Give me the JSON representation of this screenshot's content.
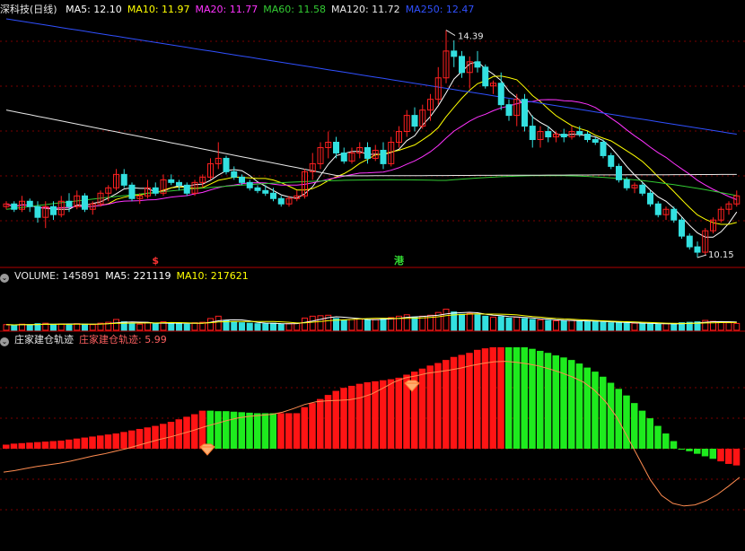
{
  "panel_main": {
    "title": "深科技(日线)",
    "ma": [
      {
        "label": "MA5: 12.10",
        "color": "#ffffff"
      },
      {
        "label": "MA10: 11.97",
        "color": "#ffff00"
      },
      {
        "label": "MA20: 11.77",
        "color": "#ff33ff"
      },
      {
        "label": "MA60: 11.58",
        "color": "#33cc33"
      },
      {
        "label": "MA120: 11.72",
        "color": "#e8e8e8"
      },
      {
        "label": "MA250: 12.47",
        "color": "#3050ff"
      }
    ],
    "high_label": "14.39",
    "low_label": "10.15",
    "markers": [
      {
        "text": "$",
        "color": "#ff3333"
      },
      {
        "text": "港",
        "color": "#33dd33"
      }
    ]
  },
  "panel_volume": {
    "items": [
      {
        "label": "VOLUME: 145891",
        "color": "#e8e8e8"
      },
      {
        "label": "MA5: 221119",
        "color": "#ffffff"
      },
      {
        "label": "MA10: 217621",
        "color": "#ffff00"
      }
    ]
  },
  "panel_indicator": {
    "title": "庄家建仓轨迹",
    "value_label": "庄家建仓轨迹: 5.99",
    "value_color": "#ff6060"
  },
  "colors": {
    "up": "#ff2020",
    "down": "#33e0e0",
    "bar_up": "#ff1414",
    "bar_down": "#1eeb1e",
    "curve": "#ff8c50",
    "grid": "#7a0000"
  },
  "chart_data": {
    "type": "candlestick",
    "series": [
      {
        "name": "深科技(日线)",
        "type": "candlestick",
        "ohlc": [
          [
            11.1,
            11.2,
            11.05,
            11.15
          ],
          [
            11.15,
            11.2,
            11.0,
            11.05
          ],
          [
            11.05,
            11.3,
            11.0,
            11.2
          ],
          [
            11.2,
            11.25,
            11.0,
            11.1
          ],
          [
            11.1,
            11.2,
            10.8,
            10.9
          ],
          [
            10.9,
            11.2,
            10.7,
            11.1
          ],
          [
            11.1,
            11.2,
            10.85,
            10.95
          ],
          [
            10.95,
            11.3,
            10.9,
            11.2
          ],
          [
            11.2,
            11.35,
            11.0,
            11.1
          ],
          [
            11.1,
            11.4,
            11.05,
            11.3
          ],
          [
            11.3,
            11.35,
            11.0,
            11.05
          ],
          [
            11.05,
            11.2,
            10.95,
            11.15
          ],
          [
            11.15,
            11.4,
            11.1,
            11.35
          ],
          [
            11.35,
            11.5,
            11.2,
            11.45
          ],
          [
            11.45,
            11.8,
            11.4,
            11.7
          ],
          [
            11.7,
            11.8,
            11.45,
            11.5
          ],
          [
            11.5,
            11.55,
            11.2,
            11.25
          ],
          [
            11.25,
            11.35,
            11.15,
            11.3
          ],
          [
            11.3,
            11.6,
            11.25,
            11.45
          ],
          [
            11.45,
            11.55,
            11.3,
            11.35
          ],
          [
            11.35,
            11.7,
            11.3,
            11.6
          ],
          [
            11.6,
            11.7,
            11.5,
            11.55
          ],
          [
            11.55,
            11.6,
            11.4,
            11.5
          ],
          [
            11.5,
            11.55,
            11.3,
            11.35
          ],
          [
            11.35,
            11.6,
            11.3,
            11.55
          ],
          [
            11.55,
            11.7,
            11.45,
            11.65
          ],
          [
            11.65,
            12.0,
            11.6,
            11.9
          ],
          [
            11.9,
            12.3,
            11.8,
            12.0
          ],
          [
            12.0,
            12.05,
            11.7,
            11.75
          ],
          [
            11.75,
            11.85,
            11.6,
            11.65
          ],
          [
            11.65,
            11.7,
            11.5,
            11.55
          ],
          [
            11.55,
            11.6,
            11.4,
            11.45
          ],
          [
            11.45,
            11.5,
            11.35,
            11.4
          ],
          [
            11.4,
            11.5,
            11.3,
            11.35
          ],
          [
            11.35,
            11.45,
            11.2,
            11.25
          ],
          [
            11.25,
            11.3,
            11.1,
            11.15
          ],
          [
            11.15,
            11.3,
            11.1,
            11.25
          ],
          [
            11.25,
            11.4,
            11.2,
            11.3
          ],
          [
            11.3,
            11.8,
            11.25,
            11.75
          ],
          [
            11.75,
            12.1,
            11.6,
            11.9
          ],
          [
            11.9,
            12.3,
            11.8,
            12.2
          ],
          [
            12.2,
            12.5,
            12.0,
            12.3
          ],
          [
            12.3,
            12.4,
            12.0,
            12.1
          ],
          [
            12.1,
            12.2,
            11.9,
            11.95
          ],
          [
            11.95,
            12.2,
            11.9,
            12.1
          ],
          [
            12.1,
            12.3,
            12.0,
            12.2
          ],
          [
            12.2,
            12.3,
            11.9,
            12.0
          ],
          [
            12.0,
            12.25,
            11.95,
            12.15
          ],
          [
            12.15,
            12.3,
            11.8,
            11.9
          ],
          [
            11.9,
            12.4,
            11.85,
            12.3
          ],
          [
            12.3,
            12.6,
            12.2,
            12.5
          ],
          [
            12.5,
            12.9,
            12.4,
            12.8
          ],
          [
            12.8,
            12.95,
            12.5,
            12.6
          ],
          [
            12.6,
            13.0,
            12.55,
            12.9
          ],
          [
            12.9,
            13.2,
            12.7,
            13.1
          ],
          [
            13.1,
            13.7,
            13.0,
            13.5
          ],
          [
            13.5,
            14.39,
            13.4,
            14.0
          ],
          [
            14.0,
            14.2,
            13.7,
            13.9
          ],
          [
            13.9,
            14.0,
            13.5,
            13.6
          ],
          [
            13.6,
            13.9,
            13.3,
            13.8
          ],
          [
            13.8,
            14.0,
            13.6,
            13.7
          ],
          [
            13.7,
            13.75,
            13.3,
            13.35
          ],
          [
            13.35,
            13.45,
            13.2,
            13.4
          ],
          [
            13.4,
            13.6,
            12.9,
            13.0
          ],
          [
            13.0,
            13.1,
            12.7,
            12.8
          ],
          [
            12.8,
            13.2,
            12.6,
            13.1
          ],
          [
            13.1,
            13.2,
            12.5,
            12.6
          ],
          [
            12.6,
            12.8,
            12.2,
            12.35
          ],
          [
            12.35,
            12.6,
            12.2,
            12.5
          ],
          [
            12.5,
            12.6,
            12.3,
            12.4
          ],
          [
            12.4,
            12.5,
            12.3,
            12.45
          ],
          [
            12.45,
            12.55,
            12.3,
            12.4
          ],
          [
            12.4,
            12.6,
            12.35,
            12.5
          ],
          [
            12.5,
            12.6,
            12.4,
            12.45
          ],
          [
            12.45,
            12.5,
            12.3,
            12.35
          ],
          [
            12.35,
            12.4,
            12.25,
            12.3
          ],
          [
            12.3,
            12.35,
            12.0,
            12.05
          ],
          [
            12.05,
            12.1,
            11.8,
            11.85
          ],
          [
            11.85,
            11.9,
            11.55,
            11.6
          ],
          [
            11.6,
            11.65,
            11.4,
            11.45
          ],
          [
            11.45,
            11.55,
            11.35,
            11.5
          ],
          [
            11.5,
            11.55,
            11.3,
            11.35
          ],
          [
            11.35,
            11.4,
            11.1,
            11.15
          ],
          [
            11.15,
            11.2,
            10.9,
            10.95
          ],
          [
            10.95,
            11.1,
            10.85,
            11.05
          ],
          [
            11.05,
            11.1,
            10.8,
            10.85
          ],
          [
            10.85,
            10.9,
            10.5,
            10.55
          ],
          [
            10.55,
            10.6,
            10.3,
            10.35
          ],
          [
            10.35,
            10.45,
            10.15,
            10.25
          ],
          [
            10.25,
            10.7,
            10.2,
            10.65
          ],
          [
            10.65,
            10.9,
            10.6,
            10.85
          ],
          [
            10.85,
            11.1,
            10.8,
            11.05
          ],
          [
            11.05,
            11.2,
            10.95,
            11.15
          ],
          [
            11.15,
            11.4,
            11.1,
            11.3
          ]
        ]
      }
    ],
    "volume": [
      120,
      110,
      130,
      115,
      140,
      150,
      120,
      135,
      125,
      140,
      130,
      120,
      150,
      170,
      230,
      180,
      150,
      130,
      160,
      140,
      180,
      150,
      140,
      130,
      160,
      170,
      250,
      300,
      210,
      180,
      160,
      150,
      140,
      140,
      150,
      130,
      140,
      150,
      260,
      300,
      310,
      320,
      250,
      210,
      230,
      240,
      220,
      230,
      250,
      270,
      300,
      330,
      280,
      300,
      320,
      380,
      450,
      390,
      340,
      360,
      330,
      300,
      280,
      290,
      260,
      280,
      250,
      230,
      220,
      210,
      200,
      200,
      210,
      200,
      190,
      180,
      170,
      160,
      160,
      150,
      150,
      140,
      140,
      130,
      140,
      130,
      160,
      170,
      180,
      210,
      190,
      170,
      160,
      146
    ],
    "ma_lines": [
      "MA5",
      "MA10",
      "MA20",
      "MA60",
      "MA120",
      "MA250"
    ],
    "indicator_bars": [
      8,
      10,
      11,
      12,
      13,
      14,
      15,
      16,
      18,
      20,
      22,
      24,
      26,
      28,
      30,
      33,
      36,
      39,
      42,
      45,
      49,
      53,
      58,
      63,
      68,
      75,
      75,
      74,
      74,
      73,
      72,
      71,
      70,
      70,
      70,
      70,
      70,
      70,
      82,
      90,
      98,
      106,
      114,
      120,
      124,
      128,
      131,
      133,
      135,
      137,
      140,
      146,
      152,
      158,
      164,
      169,
      175,
      181,
      185,
      189,
      195,
      198,
      200,
      200,
      200,
      200,
      200,
      197,
      193,
      189,
      184,
      180,
      175,
      168,
      160,
      152,
      142,
      130,
      118,
      105,
      90,
      75,
      60,
      45,
      30,
      15,
      0,
      -5,
      -10,
      -15,
      -20,
      -25,
      -30,
      -33
    ],
    "indicator_colors": [
      "r",
      "r",
      "r",
      "r",
      "r",
      "r",
      "r",
      "r",
      "r",
      "r",
      "r",
      "r",
      "r",
      "r",
      "r",
      "r",
      "r",
      "r",
      "r",
      "r",
      "r",
      "r",
      "r",
      "r",
      "r",
      "r",
      "g",
      "g",
      "g",
      "g",
      "g",
      "g",
      "g",
      "g",
      "g",
      "r",
      "r",
      "r",
      "r",
      "r",
      "r",
      "r",
      "r",
      "r",
      "r",
      "r",
      "r",
      "r",
      "r",
      "r",
      "r",
      "r",
      "r",
      "r",
      "r",
      "r",
      "r",
      "r",
      "r",
      "r",
      "r",
      "r",
      "r",
      "r",
      "g",
      "g",
      "g",
      "g",
      "g",
      "g",
      "g",
      "g",
      "g",
      "g",
      "g",
      "g",
      "g",
      "g",
      "g",
      "g",
      "g",
      "g",
      "g",
      "g",
      "g",
      "g",
      "g",
      "g",
      "g",
      "g",
      "g",
      "r",
      "r",
      "r"
    ],
    "indicator_curve": [
      -45,
      -42,
      -38,
      -34,
      -31,
      -28,
      -24,
      -19,
      -14,
      -10,
      -5,
      0,
      6,
      12,
      18,
      23,
      29,
      35,
      42,
      48,
      54,
      59,
      62,
      64,
      66,
      70,
      77,
      85,
      90,
      92,
      93,
      94,
      98,
      105,
      116,
      128,
      136,
      140,
      145,
      148,
      151,
      155,
      160,
      164,
      167,
      168,
      166,
      163,
      159,
      153,
      146,
      138,
      128,
      112,
      90,
      60,
      20,
      -20,
      -60,
      -90,
      -105,
      -110,
      -108,
      -100,
      -88,
      -72,
      -55
    ],
    "indicator_value": 5.99
  }
}
